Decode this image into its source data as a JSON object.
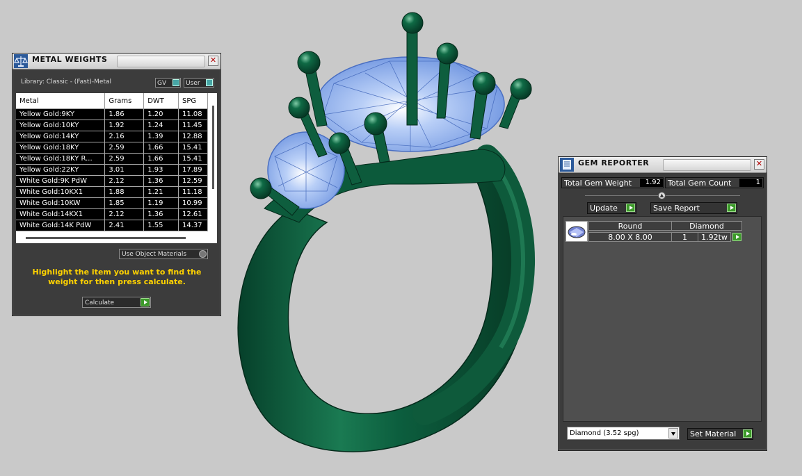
{
  "metal_weights": {
    "title": "METAL WEIGHTS",
    "library": "Library: Classic - (Fast)-Metal",
    "gv_label": "GV",
    "user_label": "User",
    "columns": [
      "Metal",
      "Grams",
      "DWT",
      "SPG"
    ],
    "rows": [
      [
        "Yellow Gold:9KY",
        "1.86",
        "1.20",
        "11.08"
      ],
      [
        "Yellow Gold:10KY",
        "1.92",
        "1.24",
        "11.45"
      ],
      [
        "Yellow Gold:14KY",
        "2.16",
        "1.39",
        "12.88"
      ],
      [
        "Yellow Gold:18KY",
        "2.59",
        "1.66",
        "15.41"
      ],
      [
        "Yellow Gold:18KY R...",
        "2.59",
        "1.66",
        "15.41"
      ],
      [
        "Yellow Gold:22KY",
        "3.01",
        "1.93",
        "17.89"
      ],
      [
        "White Gold:9K PdW",
        "2.12",
        "1.36",
        "12.59"
      ],
      [
        "White Gold:10KX1",
        "1.88",
        "1.21",
        "11.18"
      ],
      [
        "White Gold:10KW",
        "1.85",
        "1.19",
        "10.99"
      ],
      [
        "White Gold:14KX1",
        "2.12",
        "1.36",
        "12.61"
      ],
      [
        "White Gold:14K PdW",
        "2.41",
        "1.55",
        "14.37"
      ]
    ],
    "use_object_materials": "Use Object Materials",
    "hint": "Highlight the item you want to find the weight for then press calculate.",
    "calculate_label": "Calculate"
  },
  "gem_reporter": {
    "title": "GEM REPORTER",
    "total_weight_label": "Total Gem Weight",
    "total_weight_value": "1.92",
    "total_count_label": "Total Gem Count",
    "total_count_value": "1",
    "update_label": "Update",
    "save_report_label": "Save Report",
    "gem": {
      "shape": "Round",
      "material": "Diamond",
      "size": "8.00 X 8.00",
      "count": "1",
      "weight": "1.92tw"
    },
    "material_select": "Diamond      (3.52 spg)",
    "set_material_label": "Set Material"
  },
  "colors": {
    "ring_metal": "#0f5a3c",
    "gem_blue": "#8fb3f0",
    "hint_yellow": "#ffd200",
    "play_green": "#3c9a2a"
  }
}
